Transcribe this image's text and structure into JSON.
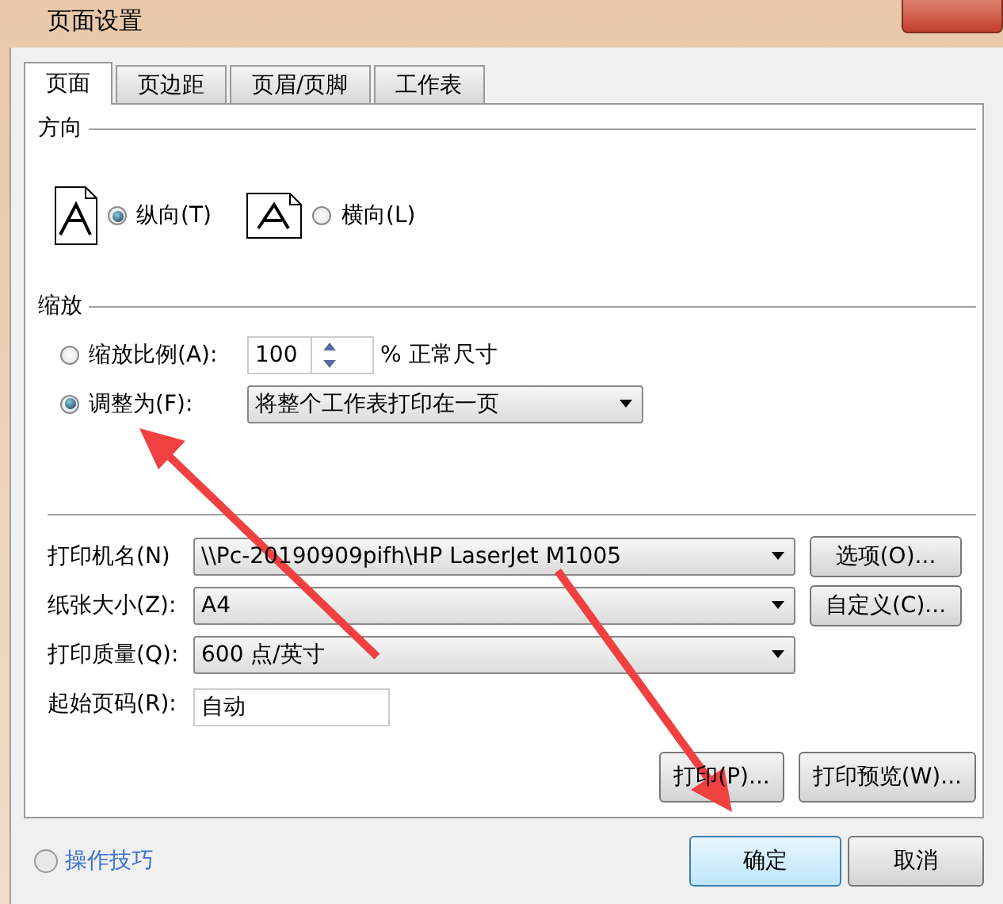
{
  "window": {
    "title": "页面设置"
  },
  "tabs": [
    {
      "label": "页面",
      "selected": true
    },
    {
      "label": "页边距",
      "selected": false
    },
    {
      "label": "页眉/页脚",
      "selected": false
    },
    {
      "label": "工作表",
      "selected": false
    }
  ],
  "orientation": {
    "heading": "方向",
    "options": [
      {
        "label": "纵向(T)",
        "selected": true
      },
      {
        "label": "横向(L)",
        "selected": false
      }
    ]
  },
  "scaling": {
    "heading": "缩放",
    "options": [
      {
        "kind": "spinner",
        "label": "缩放比例(A):",
        "selected": false,
        "value": "100",
        "suffix": "% 正常尺寸"
      },
      {
        "kind": "dropdown",
        "label": "调整为(F):",
        "selected": true,
        "value": "将整个工作表打印在一页"
      }
    ]
  },
  "printer_fields": [
    {
      "kind": "dropdown",
      "label": "打印机名(N)",
      "value": "\\\\Pc-20190909pifh\\HP LaserJet M1005",
      "button": "选项(O)..."
    },
    {
      "kind": "dropdown",
      "label": "纸张大小(Z):",
      "value": "A4",
      "button": "自定义(C)..."
    },
    {
      "kind": "dropdown",
      "label": "打印质量(Q):",
      "value": "600 点/英寸"
    },
    {
      "kind": "text",
      "label": "起始页码(R):",
      "value": "自动"
    }
  ],
  "panel_buttons": [
    "打印(P)...",
    "打印预览(W)..."
  ],
  "footer": {
    "help_link": "操作技巧",
    "buttons": [
      {
        "label": "确定",
        "default": true
      },
      {
        "label": "取消",
        "default": false
      }
    ]
  }
}
